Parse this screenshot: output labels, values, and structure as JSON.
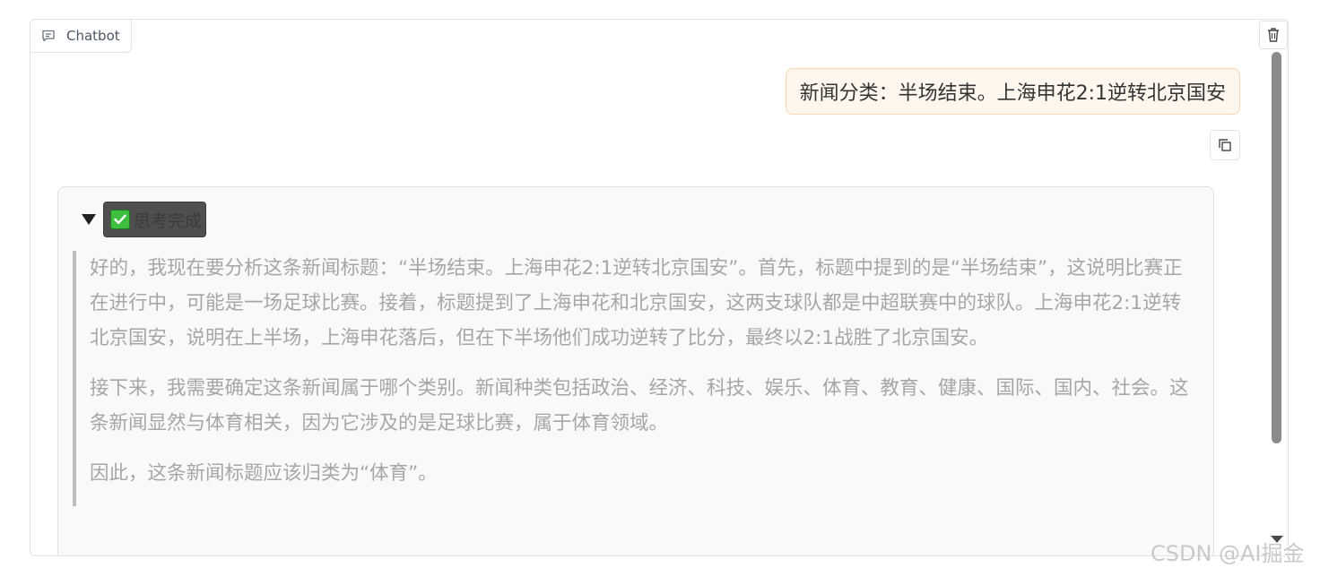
{
  "panel": {
    "label": "Chatbot"
  },
  "messages": {
    "user": {
      "text": "新闻分类：半场结束。上海申花2:1逆转北京国安"
    },
    "bot": {
      "status_label": "思考完成",
      "paragraphs": [
        "好的，我现在要分析这条新闻标题：“半场结束。上海申花2:1逆转北京国安”。首先，标题中提到的是“半场结束”，这说明比赛正在进行中，可能是一场足球比赛。接着，标题提到了上海申花和北京国安，这两支球队都是中超联赛中的球队。上海申花2:1逆转北京国安，说明在上半场，上海申花落后，但在下半场他们成功逆转了比分，最终以2:1战胜了北京国安。",
        "接下来，我需要确定这条新闻属于哪个类别。新闻种类包括政治、经济、科技、娱乐、体育、教育、健康、国际、国内、社会。这条新闻显然与体育相关，因为它涉及的是足球比赛，属于体育领域。",
        "因此，这条新闻标题应该归类为“体育”。"
      ]
    }
  },
  "watermark": "CSDN @AI掘金",
  "colors": {
    "user_bubble_bg": "#fff7ee",
    "user_bubble_border": "#f6d9b4",
    "check_green": "#3fbf3f",
    "reasoning_text": "#a6a6a6"
  },
  "icons": [
    "chat-icon",
    "trash-icon",
    "copy-icon",
    "collapse-triangle-icon",
    "checkmark-icon",
    "scroll-down-icon"
  ]
}
